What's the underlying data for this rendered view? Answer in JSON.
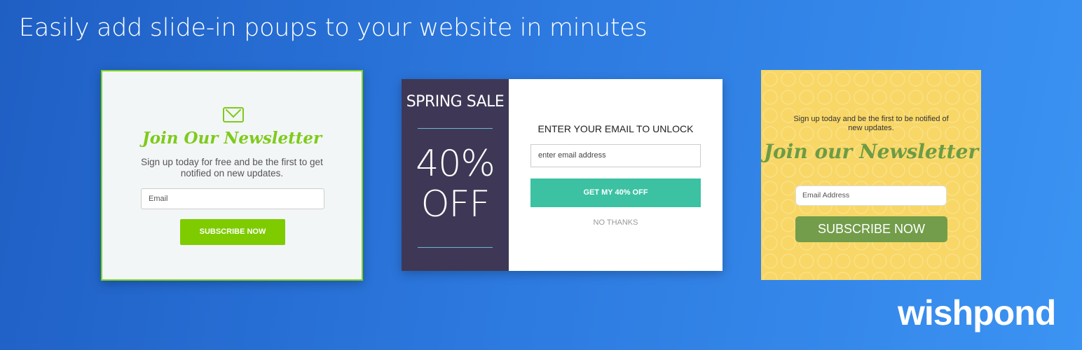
{
  "headline": "Easily add slide-in poups to your website in minutes",
  "popup_newsletter_green": {
    "title": "Join Our Newsletter",
    "subtitle": "Sign up today for free and be the first to get notified on new updates.",
    "email_placeholder": "Email",
    "button": "SUBSCRIBE NOW",
    "accent": "#7ecb00"
  },
  "popup_spring_sale": {
    "label": "SPRING SALE",
    "discount_line1": "40%",
    "discount_line2": "OFF",
    "heading": "ENTER YOUR EMAIL TO UNLOCK",
    "email_placeholder": "enter email address",
    "button": "GET MY 40% OFF",
    "decline": "NO THANKS",
    "accent": "#3cc1a2"
  },
  "popup_newsletter_yellow": {
    "subtitle": "Sign up today and be the first to be notified of new updates.",
    "title": "Join our Newsletter",
    "email_placeholder": "Email Address",
    "button": "SUBSCRIBE NOW",
    "accent": "#739d4a"
  },
  "brand": "wishpond"
}
